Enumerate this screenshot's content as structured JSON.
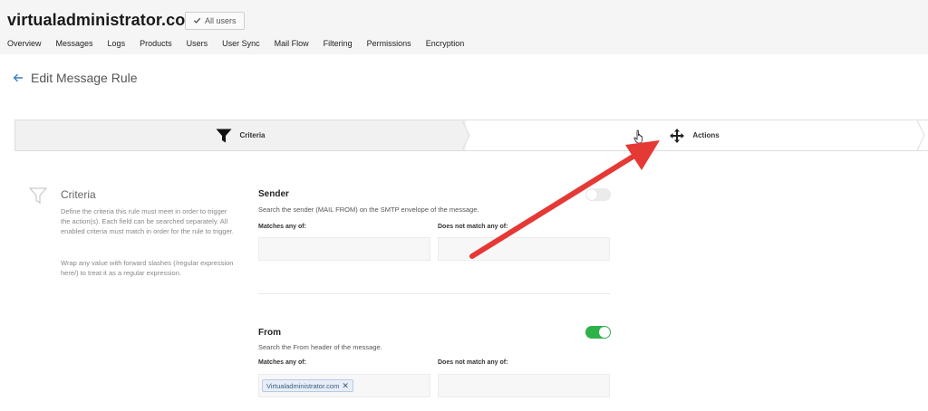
{
  "header": {
    "domain": "virtualadministrator.com",
    "users_button": "All users"
  },
  "nav": [
    "Overview",
    "Messages",
    "Logs",
    "Products",
    "Users",
    "User Sync",
    "Mail Flow",
    "Filtering",
    "Permissions",
    "Encryption"
  ],
  "page": {
    "title": "Edit Message Rule"
  },
  "steps": {
    "criteria": "Criteria",
    "actions": "Actions"
  },
  "criteria_panel": {
    "title": "Criteria",
    "description": "Define the criteria this rule must meet in order to trigger the action(s). Each field can be searched separately. All enabled criteria must match in order for the rule to trigger.",
    "regex_hint": "Wrap any value with forward slashes (/regular expression here/) to treat it as a regular expression."
  },
  "sender": {
    "title": "Sender",
    "description": "Search the sender (MAIL FROM) on the SMTP envelope of the message.",
    "matches_label": "Matches any of:",
    "not_match_label": "Does not match any of:",
    "enabled": false
  },
  "from": {
    "title": "From",
    "description": "Search the From header of the message.",
    "matches_label": "Matches any of:",
    "not_match_label": "Does not match any of:",
    "enabled": true,
    "tag": "Virtualadministrator.com"
  },
  "colors": {
    "toggle_on": "#2db24a",
    "annotation_arrow": "#e53935"
  },
  "icons": [
    "check-icon",
    "back-arrow-icon",
    "funnel-icon",
    "move-icon",
    "hand-pointer-icon",
    "close-icon"
  ]
}
